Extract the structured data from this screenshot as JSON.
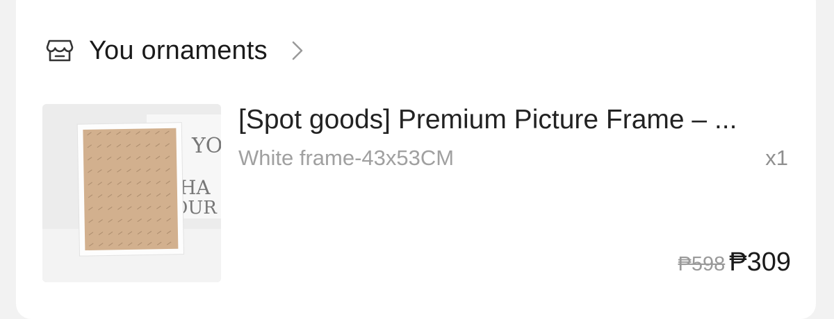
{
  "shop": {
    "name": "You ornaments",
    "icon": "store-icon",
    "link_icon": "chevron-right-icon"
  },
  "item": {
    "title": "[Spot goods] Premium Picture Frame – ...",
    "variant": "White frame-43x53CM",
    "quantity": "x1",
    "original_price": "₱598",
    "price": "₱309",
    "thumbnail": {
      "poster_text": [
        "YO",
        "HA",
        "OUR"
      ]
    }
  },
  "colors": {
    "card_bg": "#ffffff",
    "page_bg": "#f2f2f2",
    "text_primary": "#1a1a1a",
    "text_secondary": "#a0a0a0"
  }
}
